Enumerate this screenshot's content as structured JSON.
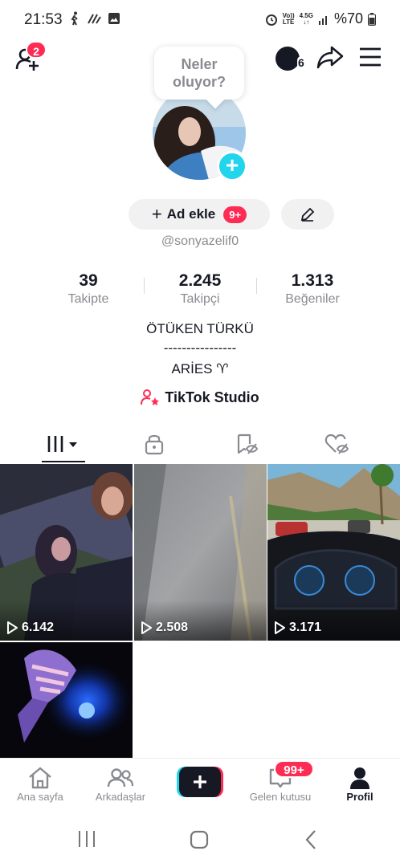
{
  "status_bar": {
    "time": "21:53",
    "network_top": "Vo))",
    "network_bottom": "LTE",
    "data_top": "4.5G",
    "battery": "%70"
  },
  "top_bar": {
    "friend_requests_count": "2",
    "notif_count": "6"
  },
  "profile": {
    "bubble_line1": "Neler",
    "bubble_line2": "oluyor?",
    "add_name_label": "Ad ekle",
    "add_name_badge": "9+",
    "username": "@sonyazelif0"
  },
  "stats": [
    {
      "value": "39",
      "label": "Takipte"
    },
    {
      "value": "2.245",
      "label": "Takipçi"
    },
    {
      "value": "1.313",
      "label": "Beğeniler"
    }
  ],
  "bio": {
    "line1": "ÖTÜKEN TÜRKÜ",
    "line2": "----------------",
    "line3": "ARİES ♈",
    "studio_label": "TikTok Studio"
  },
  "videos": [
    {
      "views": "6.142"
    },
    {
      "views": "2.508"
    },
    {
      "views": "3.171"
    },
    {
      "views": ""
    }
  ],
  "bottom_nav": {
    "home": "Ana sayfa",
    "friends": "Arkadaşlar",
    "inbox": "Gelen kutusu",
    "inbox_badge": "99+",
    "profile": "Profil"
  },
  "colors": {
    "accent_red": "#fe2c55",
    "accent_cyan": "#20d5ec",
    "text_primary": "#161823",
    "text_secondary": "#8a8b91"
  }
}
